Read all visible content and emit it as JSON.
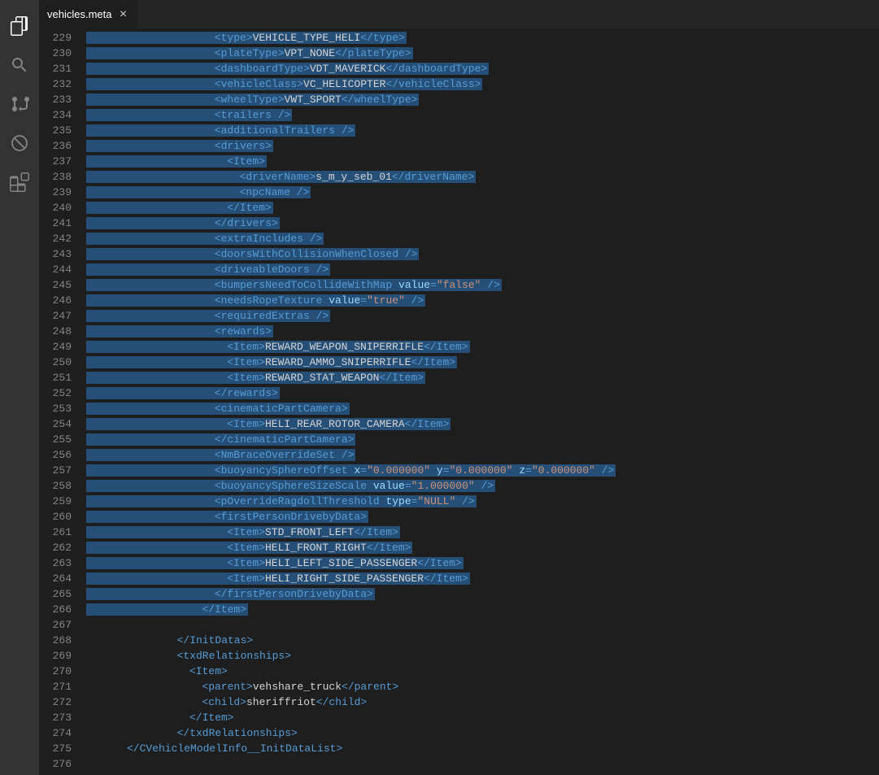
{
  "tab": {
    "name": "vehicles.meta",
    "close": "×"
  },
  "startLine": 229,
  "lines": [
    {
      "indent": 7,
      "sel": true,
      "parts": [
        {
          "c": "tag",
          "t": "<type>"
        },
        {
          "c": "txt",
          "t": "VEHICLE_TYPE_HELI"
        },
        {
          "c": "tag",
          "t": "</type>"
        }
      ]
    },
    {
      "indent": 7,
      "sel": true,
      "parts": [
        {
          "c": "tag",
          "t": "<plateType>"
        },
        {
          "c": "txt",
          "t": "VPT_NONE"
        },
        {
          "c": "tag",
          "t": "</plateType>"
        }
      ]
    },
    {
      "indent": 7,
      "sel": true,
      "parts": [
        {
          "c": "tag",
          "t": "<dashboardType>"
        },
        {
          "c": "txt",
          "t": "VDT_MAVERICK"
        },
        {
          "c": "tag",
          "t": "</dashboardType>"
        }
      ]
    },
    {
      "indent": 7,
      "sel": true,
      "parts": [
        {
          "c": "tag",
          "t": "<vehicleClass>"
        },
        {
          "c": "txt",
          "t": "VC_HELICOPTER"
        },
        {
          "c": "tag",
          "t": "</vehicleClass>"
        }
      ]
    },
    {
      "indent": 7,
      "sel": true,
      "parts": [
        {
          "c": "tag",
          "t": "<wheelType>"
        },
        {
          "c": "txt",
          "t": "VWT_SPORT"
        },
        {
          "c": "tag",
          "t": "</wheelType>"
        }
      ]
    },
    {
      "indent": 7,
      "sel": true,
      "parts": [
        {
          "c": "tag",
          "t": "<trailers />"
        }
      ]
    },
    {
      "indent": 7,
      "sel": true,
      "parts": [
        {
          "c": "tag",
          "t": "<additionalTrailers />"
        }
      ]
    },
    {
      "indent": 7,
      "sel": true,
      "parts": [
        {
          "c": "tag",
          "t": "<drivers>"
        }
      ]
    },
    {
      "indent": 8,
      "sel": true,
      "parts": [
        {
          "c": "tag",
          "t": "<Item>"
        }
      ]
    },
    {
      "indent": 9,
      "sel": true,
      "parts": [
        {
          "c": "tag",
          "t": "<driverName>"
        },
        {
          "c": "txt",
          "t": "s_m_y_seb_01"
        },
        {
          "c": "tag",
          "t": "</driverName>"
        }
      ]
    },
    {
      "indent": 9,
      "sel": true,
      "parts": [
        {
          "c": "tag",
          "t": "<npcName />"
        }
      ]
    },
    {
      "indent": 8,
      "sel": true,
      "parts": [
        {
          "c": "tag",
          "t": "</Item>"
        }
      ]
    },
    {
      "indent": 7,
      "sel": true,
      "parts": [
        {
          "c": "tag",
          "t": "</drivers>"
        }
      ]
    },
    {
      "indent": 7,
      "sel": true,
      "parts": [
        {
          "c": "tag",
          "t": "<extraIncludes />"
        }
      ]
    },
    {
      "indent": 7,
      "sel": true,
      "parts": [
        {
          "c": "tag",
          "t": "<doorsWithCollisionWhenClosed />"
        }
      ]
    },
    {
      "indent": 7,
      "sel": true,
      "parts": [
        {
          "c": "tag",
          "t": "<driveableDoors />"
        }
      ]
    },
    {
      "indent": 7,
      "sel": true,
      "parts": [
        {
          "c": "tag",
          "t": "<bumpersNeedToCollideWithMap "
        },
        {
          "c": "attr",
          "t": "value"
        },
        {
          "c": "tag",
          "t": "="
        },
        {
          "c": "str",
          "t": "\"false\""
        },
        {
          "c": "tag",
          "t": " />"
        }
      ]
    },
    {
      "indent": 7,
      "sel": true,
      "parts": [
        {
          "c": "tag",
          "t": "<needsRopeTexture "
        },
        {
          "c": "attr",
          "t": "value"
        },
        {
          "c": "tag",
          "t": "="
        },
        {
          "c": "str",
          "t": "\"true\""
        },
        {
          "c": "tag",
          "t": " />"
        }
      ]
    },
    {
      "indent": 7,
      "sel": true,
      "parts": [
        {
          "c": "tag",
          "t": "<requiredExtras />"
        }
      ]
    },
    {
      "indent": 7,
      "sel": true,
      "parts": [
        {
          "c": "tag",
          "t": "<rewards>"
        }
      ]
    },
    {
      "indent": 8,
      "sel": true,
      "parts": [
        {
          "c": "tag",
          "t": "<Item>"
        },
        {
          "c": "txt",
          "t": "REWARD_WEAPON_SNIPERRIFLE"
        },
        {
          "c": "tag",
          "t": "</Item>"
        }
      ]
    },
    {
      "indent": 8,
      "sel": true,
      "parts": [
        {
          "c": "tag",
          "t": "<Item>"
        },
        {
          "c": "txt",
          "t": "REWARD_AMMO_SNIPERRIFLE"
        },
        {
          "c": "tag",
          "t": "</Item>"
        }
      ]
    },
    {
      "indent": 8,
      "sel": true,
      "parts": [
        {
          "c": "tag",
          "t": "<Item>"
        },
        {
          "c": "txt",
          "t": "REWARD_STAT_WEAPON"
        },
        {
          "c": "tag",
          "t": "</Item>"
        }
      ]
    },
    {
      "indent": 7,
      "sel": true,
      "parts": [
        {
          "c": "tag",
          "t": "</rewards>"
        }
      ]
    },
    {
      "indent": 7,
      "sel": true,
      "parts": [
        {
          "c": "tag",
          "t": "<cinematicPartCamera>"
        }
      ]
    },
    {
      "indent": 8,
      "sel": true,
      "parts": [
        {
          "c": "tag",
          "t": "<Item>"
        },
        {
          "c": "txt",
          "t": "HELI_REAR_ROTOR_CAMERA"
        },
        {
          "c": "tag",
          "t": "</Item>"
        }
      ]
    },
    {
      "indent": 7,
      "sel": true,
      "parts": [
        {
          "c": "tag",
          "t": "</cinematicPartCamera>"
        }
      ]
    },
    {
      "indent": 7,
      "sel": true,
      "parts": [
        {
          "c": "tag",
          "t": "<NmBraceOverrideSet />"
        }
      ]
    },
    {
      "indent": 7,
      "sel": true,
      "parts": [
        {
          "c": "tag",
          "t": "<buoyancySphereOffset "
        },
        {
          "c": "attr",
          "t": "x"
        },
        {
          "c": "tag",
          "t": "="
        },
        {
          "c": "str",
          "t": "\"0.000000\""
        },
        {
          "c": "tag",
          "t": " "
        },
        {
          "c": "attr",
          "t": "y"
        },
        {
          "c": "tag",
          "t": "="
        },
        {
          "c": "str",
          "t": "\"0.000000\""
        },
        {
          "c": "tag",
          "t": " "
        },
        {
          "c": "attr",
          "t": "z"
        },
        {
          "c": "tag",
          "t": "="
        },
        {
          "c": "str",
          "t": "\"0.000000\""
        },
        {
          "c": "tag",
          "t": " />"
        }
      ]
    },
    {
      "indent": 7,
      "sel": true,
      "parts": [
        {
          "c": "tag",
          "t": "<buoyancySphereSizeScale "
        },
        {
          "c": "attr",
          "t": "value"
        },
        {
          "c": "tag",
          "t": "="
        },
        {
          "c": "str",
          "t": "\"1.000000\""
        },
        {
          "c": "tag",
          "t": " />"
        }
      ]
    },
    {
      "indent": 7,
      "sel": true,
      "parts": [
        {
          "c": "tag",
          "t": "<pOverrideRagdollThreshold "
        },
        {
          "c": "attr",
          "t": "type"
        },
        {
          "c": "tag",
          "t": "="
        },
        {
          "c": "str",
          "t": "\"NULL\""
        },
        {
          "c": "tag",
          "t": " />"
        }
      ]
    },
    {
      "indent": 7,
      "sel": true,
      "parts": [
        {
          "c": "tag",
          "t": "<firstPersonDrivebyData>"
        }
      ]
    },
    {
      "indent": 8,
      "sel": true,
      "parts": [
        {
          "c": "tag",
          "t": "<Item>"
        },
        {
          "c": "txt",
          "t": "STD_FRONT_LEFT"
        },
        {
          "c": "tag",
          "t": "</Item>"
        }
      ]
    },
    {
      "indent": 8,
      "sel": true,
      "parts": [
        {
          "c": "tag",
          "t": "<Item>"
        },
        {
          "c": "txt",
          "t": "HELI_FRONT_RIGHT"
        },
        {
          "c": "tag",
          "t": "</Item>"
        }
      ]
    },
    {
      "indent": 8,
      "sel": true,
      "parts": [
        {
          "c": "tag",
          "t": "<Item>"
        },
        {
          "c": "txt",
          "t": "HELI_LEFT_SIDE_PASSENGER"
        },
        {
          "c": "tag",
          "t": "</Item>"
        }
      ]
    },
    {
      "indent": 8,
      "sel": true,
      "parts": [
        {
          "c": "tag",
          "t": "<Item>"
        },
        {
          "c": "txt",
          "t": "HELI_RIGHT_SIDE_PASSENGER"
        },
        {
          "c": "tag",
          "t": "</Item>"
        }
      ]
    },
    {
      "indent": 7,
      "sel": true,
      "parts": [
        {
          "c": "tag",
          "t": "</firstPersonDrivebyData>"
        }
      ]
    },
    {
      "indent": 6,
      "sel": true,
      "parts": [
        {
          "c": "tag",
          "t": "</Item>"
        }
      ]
    },
    {
      "indent": 0,
      "sel": false,
      "parts": []
    },
    {
      "indent": 4,
      "sel": false,
      "parts": [
        {
          "c": "tag",
          "t": "</InitDatas>"
        }
      ]
    },
    {
      "indent": 4,
      "sel": false,
      "parts": [
        {
          "c": "tag",
          "t": "<txdRelationships>"
        }
      ]
    },
    {
      "indent": 5,
      "sel": false,
      "parts": [
        {
          "c": "tag",
          "t": "<Item>"
        }
      ]
    },
    {
      "indent": 6,
      "sel": false,
      "parts": [
        {
          "c": "tag",
          "t": "<parent>"
        },
        {
          "c": "txt",
          "t": "vehshare_truck"
        },
        {
          "c": "tag",
          "t": "</parent>"
        }
      ]
    },
    {
      "indent": 6,
      "sel": false,
      "parts": [
        {
          "c": "tag",
          "t": "<child>"
        },
        {
          "c": "txt",
          "t": "sheriffriot"
        },
        {
          "c": "tag",
          "t": "</child>"
        }
      ]
    },
    {
      "indent": 5,
      "sel": false,
      "parts": [
        {
          "c": "tag",
          "t": "</Item>"
        }
      ]
    },
    {
      "indent": 4,
      "sel": false,
      "parts": [
        {
          "c": "tag",
          "t": "</txdRelationships>"
        }
      ]
    },
    {
      "indent": 0,
      "sel": false,
      "parts": [
        {
          "c": "tag",
          "t": "</CVehicleModelInfo__InitDataList>"
        }
      ]
    },
    {
      "indent": 0,
      "sel": false,
      "parts": []
    }
  ]
}
